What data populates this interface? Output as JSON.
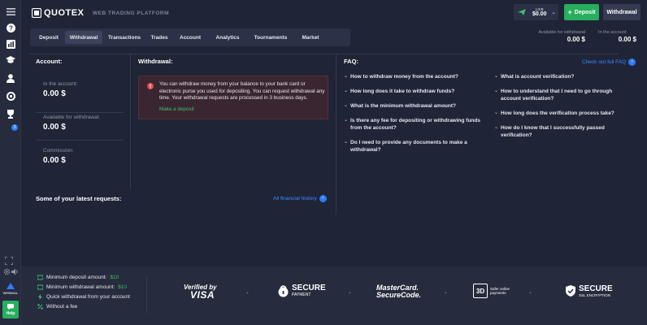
{
  "brand": {
    "name": "QUOTEX",
    "platform": "WEB TRADING PLATFORM"
  },
  "header": {
    "account_mode": "LIVE",
    "balance": "$0.00",
    "deposit_label": "Deposit",
    "withdrawal_label": "Withdrawal",
    "available_label": "Available for withdrawal",
    "available_value": "0.00 $",
    "in_account_label": "In the account",
    "in_account_value": "0.00 $"
  },
  "sidebar": {
    "items": [
      "help",
      "chart",
      "education",
      "profile",
      "support",
      "trophy"
    ],
    "trophy_badge": "3",
    "bottom_label": "WEBINAL",
    "help_label": "Help"
  },
  "tabs": [
    "Deposit",
    "Withdrawal",
    "Transactions",
    "Trades",
    "Account",
    "Analytics",
    "Tournaments",
    "Market"
  ],
  "active_tab": "Withdrawal",
  "account": {
    "title": "Account:",
    "in_account_label": "In the account:",
    "in_account_value": "0.00 $",
    "available_label": "Available for withdrawal:",
    "available_value": "0.00 $",
    "commission_label": "Commission:",
    "commission_value": "0.00 $"
  },
  "withdrawal": {
    "title": "Withdrawal:",
    "notice": "You can withdraw money from your balance to your bank card or electronic purse you used for depositing. You can request withdrawal any time. Your withdrawal requests are processed in 3 business days.",
    "make_deposit": "Make a deposit"
  },
  "requests": {
    "title": "Some of your latest requests:",
    "history_link": "All financial history"
  },
  "faq": {
    "title": "FAQ:",
    "full_faq_link": "Check out full FAQ",
    "left": [
      "How to withdraw money from the account?",
      "How long does it take to withdraw funds?",
      "What is the minimum withdrawal amount?",
      "Is there any fee for depositing or withdrawing funds from the account?",
      "Do I need to provide any documents to make a withdrawal?"
    ],
    "right": [
      "What is account verification?",
      "How to understand that I need to go through account verification?",
      "How long does the verification process take?",
      "How do I know that I successfully passed verification?"
    ]
  },
  "footer": {
    "features": [
      {
        "text": "Minimum deposit amount:",
        "value": "$10"
      },
      {
        "text": "Minimum withdrawal amount:",
        "value": "$10"
      },
      {
        "text": "Quick withdrawal from your account",
        "value": ""
      },
      {
        "text": "Without a fee",
        "value": ""
      }
    ],
    "visa_top": "Verified by",
    "visa_bottom": "VISA",
    "secure_payment_top": "SECURE",
    "secure_payment_bottom": "PAYMENT",
    "mastercard_top": "MasterCard.",
    "mastercard_bottom": "SecureCode.",
    "threed_label": "3D",
    "threed_text": "Safer online payments",
    "ssl_top": "SECURE",
    "ssl_bottom": "SSL ENCRYPTION"
  },
  "colors": {
    "accent_green": "#27ae5f",
    "link_blue": "#3d8bff",
    "alert_red": "#e04b4b"
  }
}
